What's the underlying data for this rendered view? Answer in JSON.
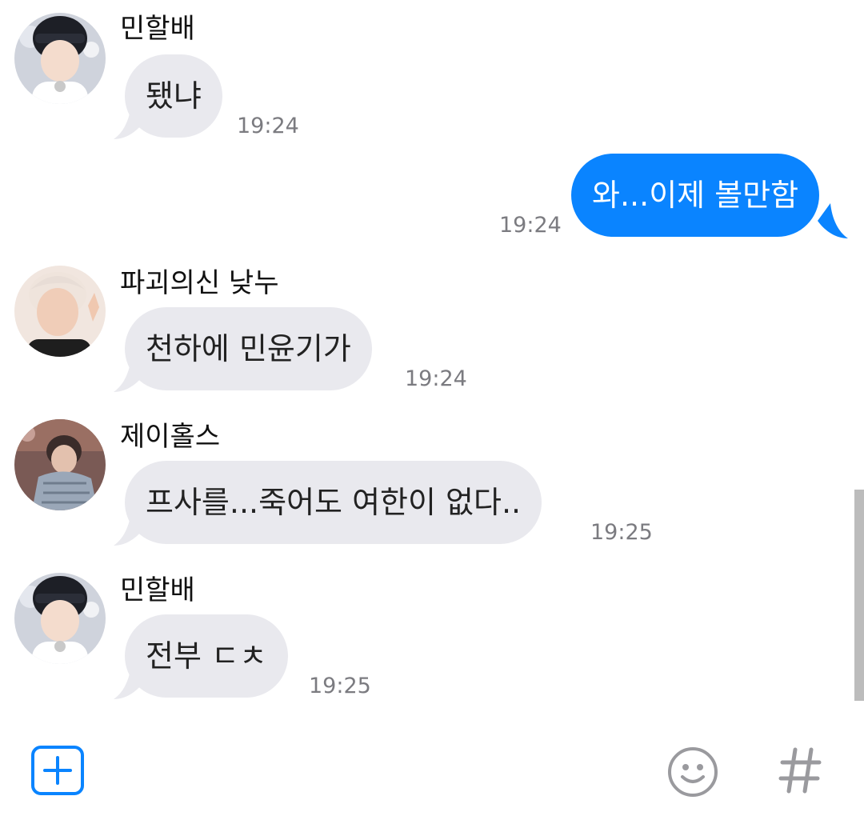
{
  "messages": [
    {
      "sender": "민할배",
      "text": "됐냐",
      "time": "19:24",
      "direction": "in"
    },
    {
      "sender": "",
      "text": "와...이제 볼만함",
      "time": "19:24",
      "direction": "out"
    },
    {
      "sender": "파괴의신 낮누",
      "text": "천하에 민윤기가",
      "time": "19:24",
      "direction": "in"
    },
    {
      "sender": "제이홀스",
      "text": "프사를...죽어도 여한이 없다..",
      "time": "19:25",
      "direction": "in"
    },
    {
      "sender": "민할배",
      "text": "전부 ㄷㅊ",
      "time": "19:25",
      "direction": "in"
    }
  ],
  "colors": {
    "incoming_bubble": "#e9e9ee",
    "outgoing_bubble": "#0a84ff",
    "accent": "#0a84ff",
    "timestamp": "#7b7b80"
  },
  "composer": {
    "add_icon": "plus-square-icon",
    "emoji_icon": "smiley-icon",
    "hashtag_icon": "hashtag-icon"
  }
}
